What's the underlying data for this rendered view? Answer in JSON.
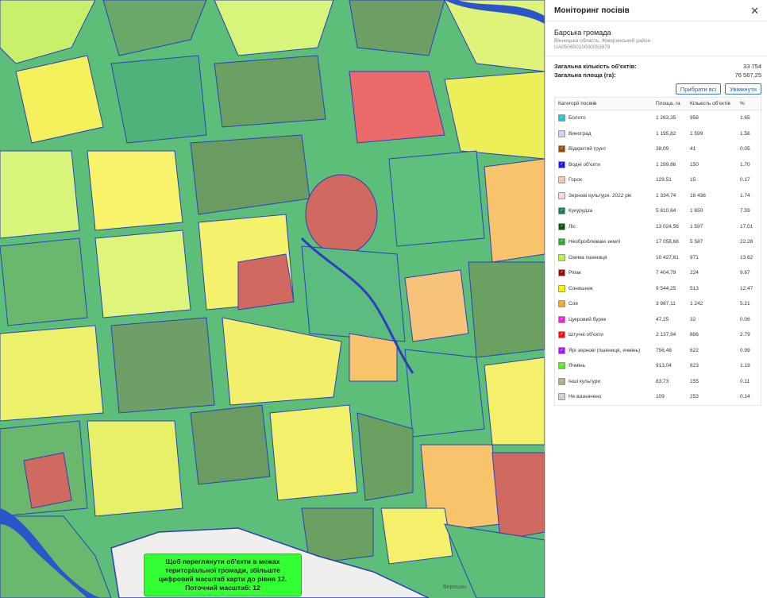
{
  "panel": {
    "title": "Моніторинг посівів",
    "close_icon": "close-icon",
    "hromada_name": "Барська громада",
    "hromada_region": "Вінницька область, Жмеринський район",
    "hromada_code": "UA05060010000053979",
    "total_objects_label": "Загальна кількість об'єктів:",
    "total_objects_value": "33 754",
    "total_area_label": "Загальна площа (га):",
    "total_area_value": "76 567,25",
    "remove_all_label": "Прибрати всі",
    "enable_label": "Увімкнути",
    "columns": {
      "category": "Категорії посівів",
      "area": "Площа, га",
      "count": "Кількість об'єктів",
      "pct": "%"
    },
    "rows": [
      {
        "label": "Болото",
        "area": "1 263,35",
        "count": "958",
        "pct": "1.65",
        "color": "#13c7d6"
      },
      {
        "label": "Виноград",
        "area": "1 195,82",
        "count": "1 599",
        "pct": "1.56",
        "color": "#c9d3f7"
      },
      {
        "label": "Відкритий грунт",
        "area": "38,09",
        "count": "41",
        "pct": "0.05",
        "color": "#8a4d12"
      },
      {
        "label": "Водні об'єкти",
        "area": "1 299,86",
        "count": "150",
        "pct": "1.70",
        "color": "#1a1ad6"
      },
      {
        "label": "Горох",
        "area": "129,51",
        "count": "15",
        "pct": "0.17",
        "color": "#f6c6ab"
      },
      {
        "label": "Зернові культури. 2022 рік",
        "area": "1 334,74",
        "count": "16 436",
        "pct": "1.74",
        "color": "#fbd1dc"
      },
      {
        "label": "Кукурудза",
        "area": "5 810,64",
        "count": "1 650",
        "pct": "7.59",
        "color": "#1c7a55"
      },
      {
        "label": "Ліс",
        "area": "13 024,56",
        "count": "1 597",
        "pct": "17.01",
        "color": "#0f4f12"
      },
      {
        "label": "Необроблювані землі",
        "area": "17 058,68",
        "count": "5 587",
        "pct": "22.28",
        "color": "#22b02a"
      },
      {
        "label": "Озима пшениця",
        "area": "10 427,61",
        "count": "971",
        "pct": "13.62",
        "color": "#b6f23a"
      },
      {
        "label": "Ріпак",
        "area": "7 404,79",
        "count": "224",
        "pct": "9.67",
        "color": "#8a1212"
      },
      {
        "label": "Соняшник",
        "area": "9 544,25",
        "count": "513",
        "pct": "12.47",
        "color": "#f3f216"
      },
      {
        "label": "Соя",
        "area": "3 987,11",
        "count": "1 242",
        "pct": "5.21",
        "color": "#f7a61c"
      },
      {
        "label": "Цукровий буряк",
        "area": "47,25",
        "count": "32",
        "pct": "0.06",
        "color": "#f21ee0"
      },
      {
        "label": "Штучні об'єкти",
        "area": "2 137,94",
        "count": "886",
        "pct": "2.79",
        "color": "#e51616"
      },
      {
        "label": "Ярі зернові (пшениця, ячмінь)",
        "area": "756,48",
        "count": "622",
        "pct": "0.99",
        "color": "#a11ee0"
      },
      {
        "label": "Ячмінь",
        "area": "913,04",
        "count": "823",
        "pct": "1.19",
        "color": "#52f016"
      },
      {
        "label": "Інші культури",
        "area": "83,73",
        "count": "155",
        "pct": "0.11",
        "color": "#b0a98a"
      },
      {
        "label": "Не визначено",
        "area": "109",
        "count": "253",
        "pct": "0.14",
        "color": "#cfcfcf"
      }
    ]
  },
  "map": {
    "notice_line1": "Щоб переглянути об'єкти в межах",
    "notice_line2": "територіальної громади, збільште",
    "notice_line3": "цифровий масштаб карти до рівня 12.",
    "notice_line4": "Поточний масштаб: 12",
    "place_label": "Верешки"
  }
}
